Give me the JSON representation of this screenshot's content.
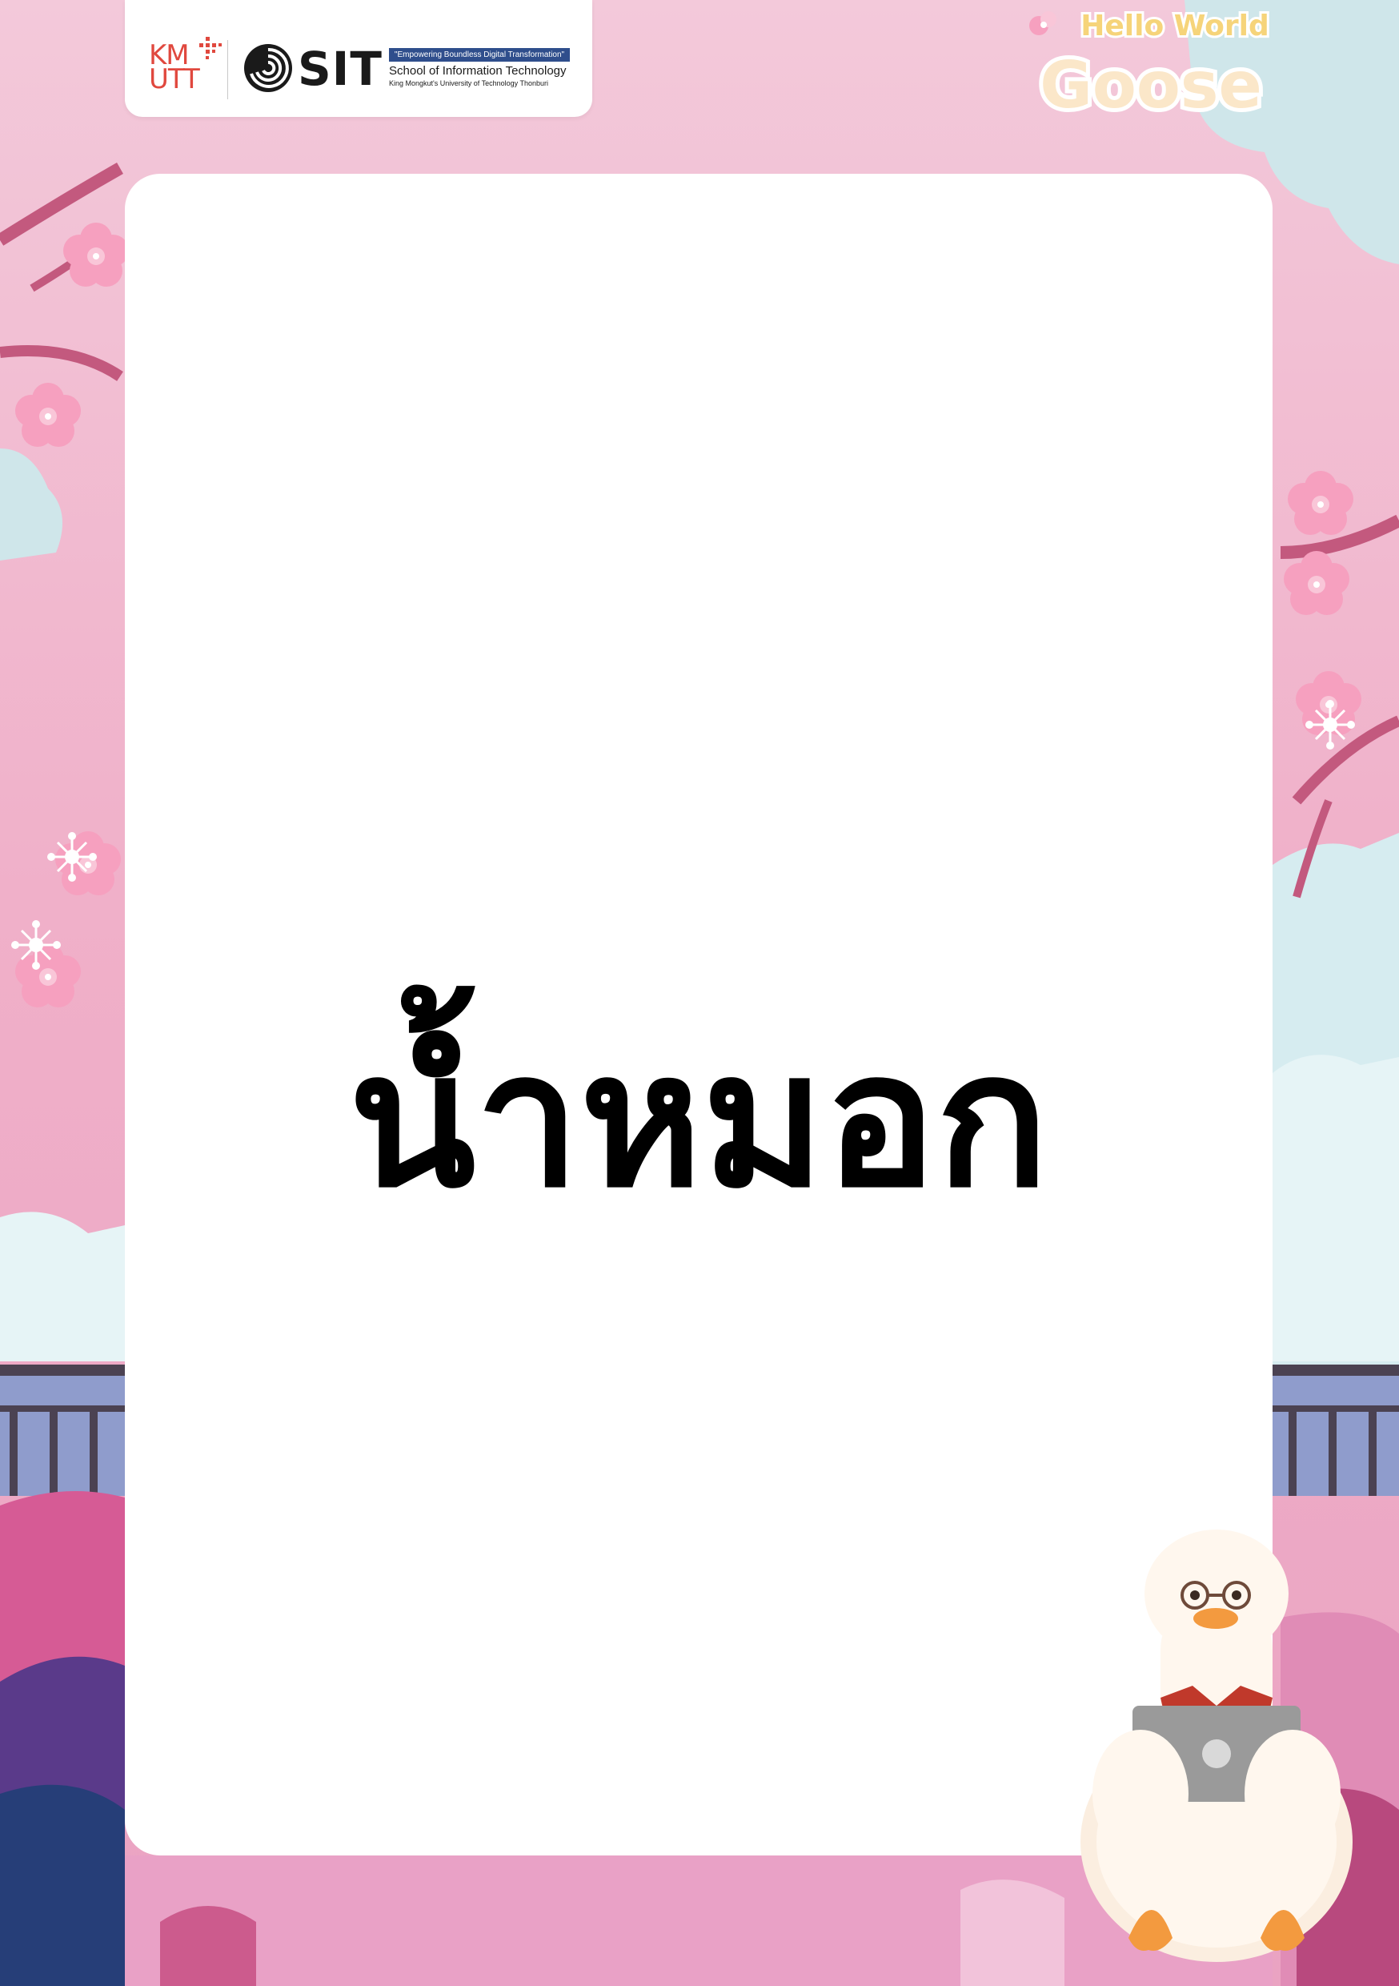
{
  "logos": {
    "kmutt_line1": "KM",
    "kmutt_line2": "UTT",
    "sit_wordmark": "SIT",
    "sit_tagline": "\"Empowering Boundless Digital Transformation\"",
    "sit_school": "School of Information Technology",
    "sit_university": "King Mongkut's University of Technology Thonburi",
    "event_line1": "Hello World",
    "event_line2": "Goose"
  },
  "card": {
    "word": "น้ำหมอก"
  },
  "colors": {
    "background_pink": "#f1b3cb",
    "card": "#ffffff",
    "word": "#000000",
    "kmutt_red": "#e0483e",
    "sit_blue": "#2f4e8c",
    "event_yellow": "#f6d47a"
  },
  "mascot": {
    "icon": "goose-with-laptop-icon"
  }
}
